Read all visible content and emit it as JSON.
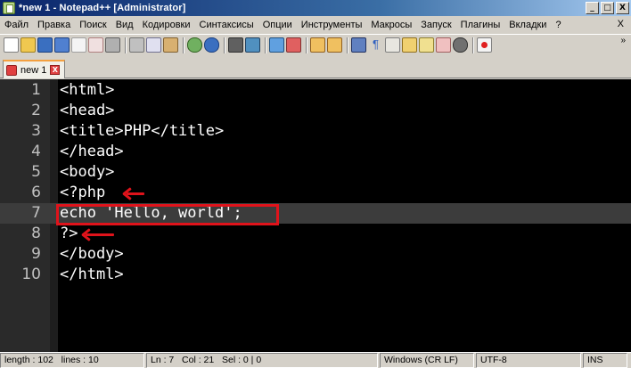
{
  "window": {
    "title": "*new 1 - Notepad++ [Administrator]",
    "minimize": "_",
    "maximize": "□",
    "close": "X"
  },
  "menu": {
    "items": [
      "Файл",
      "Правка",
      "Поиск",
      "Вид",
      "Кодировки",
      "Синтаксисы",
      "Опции",
      "Инструменты",
      "Макросы",
      "Запуск",
      "Плагины",
      "Вкладки",
      "?"
    ],
    "close_doc": "X"
  },
  "toolbar": {
    "icons": [
      "new-file-icon",
      "open-file-icon",
      "save-icon",
      "save-all-icon",
      "close-icon",
      "close-all-icon",
      "print-icon",
      "cut-icon",
      "copy-icon",
      "paste-icon",
      "undo-icon",
      "redo-icon",
      "find-icon",
      "replace-icon",
      "zoom-in-icon",
      "zoom-out-icon",
      "sync-vertical-icon",
      "sync-horizontal-icon",
      "word-wrap-icon",
      "show-all-chars-icon",
      "indent-guide-icon",
      "doc-map-icon",
      "function-list-icon",
      "folder-workspace-icon",
      "monitor-icon",
      "record-macro-icon"
    ],
    "overflow": "»"
  },
  "tabs": [
    {
      "label": "new 1",
      "close": "X"
    }
  ],
  "editor": {
    "current_line": 7,
    "lines": [
      "<html>",
      "<head>",
      "<title>PHP</title>",
      "</head>",
      "<body>",
      "<?php",
      "echo 'Hello, world';",
      "?>",
      "</body>",
      "</html>"
    ],
    "line_numbers": [
      "1",
      "2",
      "3",
      "4",
      "5",
      "6",
      "7",
      "8",
      "9",
      "10"
    ],
    "annotation_color": "#e0131b"
  },
  "status": {
    "length": "length : 102",
    "lines": "lines : 10",
    "ln": "Ln : 7",
    "col": "Col : 21",
    "sel": "Sel : 0 | 0",
    "eol": "Windows (CR LF)",
    "encoding": "UTF-8",
    "ins": "INS"
  }
}
